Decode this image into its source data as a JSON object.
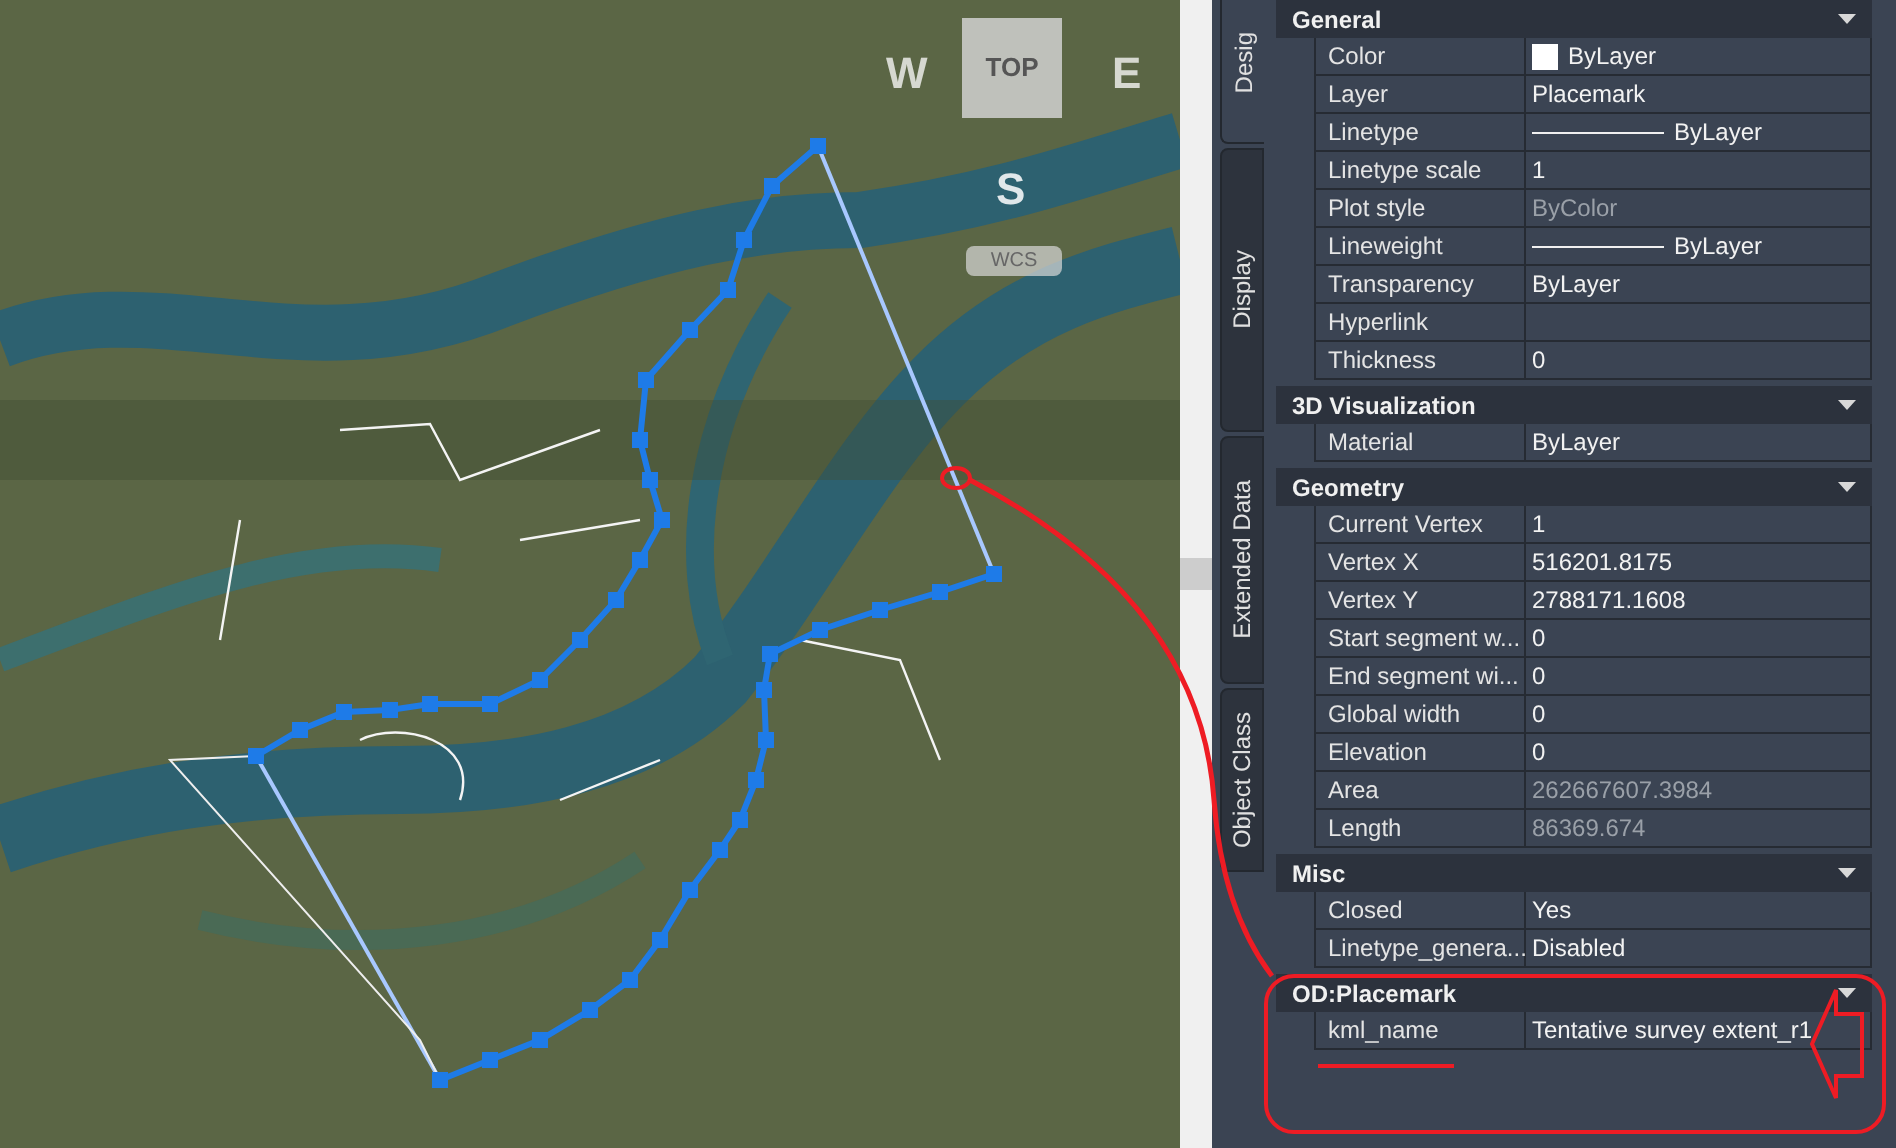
{
  "viewcube": {
    "west": "W",
    "top": "TOP",
    "east": "E",
    "south": "S",
    "coordinate_system": "WCS"
  },
  "tabs": [
    {
      "label": "Desig",
      "selected": true
    },
    {
      "label": "Display",
      "selected": false
    },
    {
      "label": "Extended Data",
      "selected": false
    },
    {
      "label": "Object Class",
      "selected": false
    }
  ],
  "sections": [
    {
      "title": "General",
      "expanded": true,
      "rows": [
        {
          "label": "Color",
          "value": "ByLayer",
          "kind": "swatch",
          "color": "#ffffff",
          "disabled": false
        },
        {
          "label": "Layer",
          "value": "Placemark",
          "kind": "text",
          "disabled": false
        },
        {
          "label": "Linetype",
          "value": "ByLayer",
          "kind": "line",
          "disabled": false
        },
        {
          "label": "Linetype scale",
          "value": "1",
          "kind": "text",
          "disabled": false
        },
        {
          "label": "Plot style",
          "value": "ByColor",
          "kind": "text",
          "disabled": true
        },
        {
          "label": "Lineweight",
          "value": "ByLayer",
          "kind": "line",
          "disabled": false
        },
        {
          "label": "Transparency",
          "value": "ByLayer",
          "kind": "text",
          "disabled": false
        },
        {
          "label": "Hyperlink",
          "value": "",
          "kind": "text",
          "disabled": false
        },
        {
          "label": "Thickness",
          "value": "0",
          "kind": "text",
          "disabled": false
        }
      ]
    },
    {
      "title": "3D Visualization",
      "expanded": true,
      "rows": [
        {
          "label": "Material",
          "value": "ByLayer",
          "kind": "text",
          "disabled": false
        }
      ]
    },
    {
      "title": "Geometry",
      "expanded": true,
      "rows": [
        {
          "label": "Current Vertex",
          "value": "1",
          "kind": "text",
          "disabled": false
        },
        {
          "label": "Vertex X",
          "value": "516201.8175",
          "kind": "text",
          "disabled": false
        },
        {
          "label": "Vertex Y",
          "value": "2788171.1608",
          "kind": "text",
          "disabled": false
        },
        {
          "label": "Start segment w...",
          "value": "0",
          "kind": "text",
          "disabled": false
        },
        {
          "label": "End segment wi...",
          "value": "0",
          "kind": "text",
          "disabled": false
        },
        {
          "label": "Global width",
          "value": "0",
          "kind": "text",
          "disabled": false
        },
        {
          "label": "Elevation",
          "value": "0",
          "kind": "text",
          "disabled": false
        },
        {
          "label": "Area",
          "value": "262667607.3984",
          "kind": "text",
          "disabled": true
        },
        {
          "label": "Length",
          "value": "86369.674",
          "kind": "text",
          "disabled": true
        }
      ]
    },
    {
      "title": "Misc",
      "expanded": true,
      "rows": [
        {
          "label": "Closed",
          "value": "Yes",
          "kind": "text",
          "disabled": false
        },
        {
          "label": "Linetype_genera...",
          "value": "Disabled",
          "kind": "text",
          "disabled": false
        }
      ]
    },
    {
      "title": "OD:Placemark",
      "expanded": true,
      "rows": [
        {
          "label": "kml_name",
          "value": "Tentative survey extent_r1",
          "kind": "text",
          "disabled": false
        }
      ]
    }
  ]
}
